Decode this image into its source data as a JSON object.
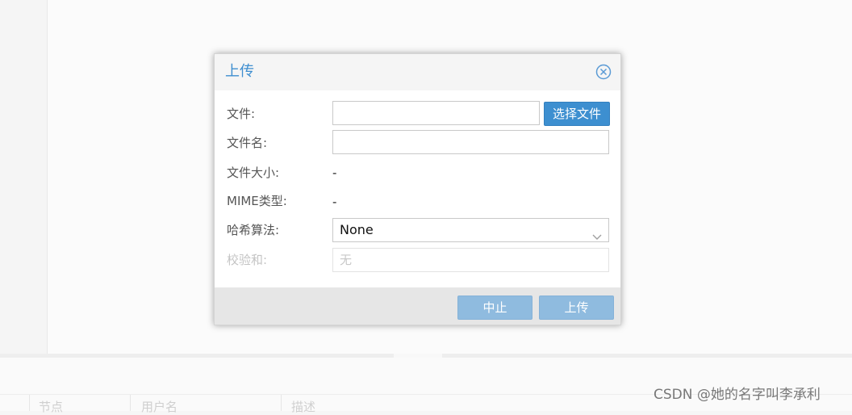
{
  "background": {
    "columns": [
      "节点",
      "用户名",
      "描述"
    ]
  },
  "dialog": {
    "title": "上传",
    "fields": {
      "file_label": "文件:",
      "filename_label": "文件名:",
      "filesize_label": "文件大小:",
      "filesize_value": "-",
      "mime_label": "MIME类型:",
      "mime_value": "-",
      "hash_label": "哈希算法:",
      "hash_value": "None",
      "checksum_label": "校验和:",
      "checksum_placeholder": "无"
    },
    "choose_file_button": "选择文件",
    "buttons": {
      "abort": "中止",
      "upload": "上传"
    }
  },
  "watermark": "CSDN @她的名字叫李承利",
  "colors": {
    "accent": "#3e8ed0",
    "button_primary": "#3d8fd0",
    "button_disabled": "#8fbbdf"
  },
  "icons": {
    "close": "close-circle-icon",
    "dropdown": "chevron-down-icon"
  }
}
